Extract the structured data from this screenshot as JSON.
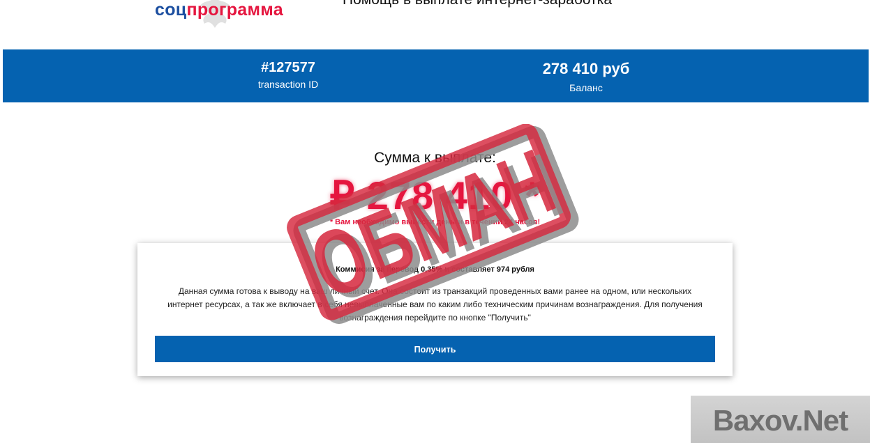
{
  "header": {
    "logo_part1": "соц",
    "logo_part2": "программа",
    "tagline": "Помощь в выплате интернет-заработка"
  },
  "stats": {
    "transaction_value": "#127577",
    "transaction_label": "transaction ID",
    "balance_value": "278 410 руб",
    "balance_label": "Баланс"
  },
  "payout": {
    "title": "Сумма к выплате:",
    "amount": "₽ 278 410 *",
    "warning": "* Вам необходимо вывести деньги в течении 24 часов!"
  },
  "card": {
    "commission": "Коммисия за перевод 0,35% и составляет 974 рубля",
    "description": "Данная сумма готова к выводу на ваш личный счет. Она состоит из транзакций проведенных вами ранее на одном, или нескольких интернет ресурсах, а так же включает в себя невыплаченные вам по каким либо техническим причинам вознаграждения. Для получения вознаграждения перейдите по кнопке \"Получить\"",
    "button_label": "Получить"
  },
  "stamp": {
    "text": "ОБМАН"
  },
  "watermark": {
    "text": "Baxov.Net"
  },
  "colors": {
    "brand_blue": "#0562b0",
    "accent_red": "#e5163f",
    "logo_blue": "#1c4fa0"
  }
}
